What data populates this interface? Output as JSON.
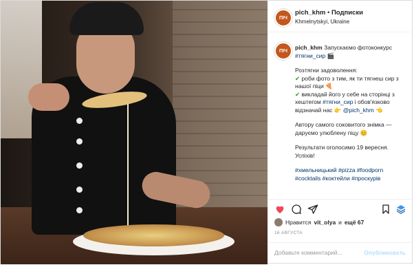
{
  "post": {
    "username": "pich_khm",
    "dot": " • ",
    "follow_label": "Подписки",
    "location": "Khmelnytskyi, Ukraine",
    "avatar_text": "ПІЧ"
  },
  "caption": {
    "username": "pich_khm",
    "line1": "Запускаємо фотоконкурс",
    "hashtag1": "#тягни_сир",
    "emoji_clapper": "🎬",
    "block2_title": "Розтягни задоволення:",
    "check1": "✔",
    "item1": "роби фото з тим, як ти тягнеш сир з нашої піци",
    "emoji_pizza": "🍕",
    "check2": "✔",
    "item2_a": "викладай його у себе на сторінці з хештегом",
    "hashtag2": "#тягни_сир",
    "item2_b": "і обов'язково відзначай нас",
    "emoji_point": "👉",
    "mention": "@pich_khm",
    "emoji_point2": "👈",
    "para3": "Автору самого соковитого знімка — даруємо улюблену піцу",
    "emoji_smile": "😊",
    "para4": "Результати оголосимо 19 вересня. Успіхів!",
    "hashtags_footer": "#хмельницький #pizza #foodporn #cocktails #коктейли #проскурів"
  },
  "actions": {
    "like_icon": "heart-icon",
    "comment_icon": "comment-icon",
    "share_icon": "share-icon",
    "save_icon": "bookmark-icon",
    "stack_icon": "layers-icon"
  },
  "likes": {
    "prefix": "Нравится",
    "user": "vit_olya",
    "and_more": "и",
    "count_text": "ещё 67"
  },
  "date": "16 АВГУСТА",
  "comment": {
    "placeholder": "Добавьте комментарий...",
    "publish_label": "Опубликовать"
  },
  "colors": {
    "heart": "#ed4956",
    "link": "#003569",
    "publish_disabled": "#b2dffc",
    "avatar_brand": "#c4571d"
  }
}
